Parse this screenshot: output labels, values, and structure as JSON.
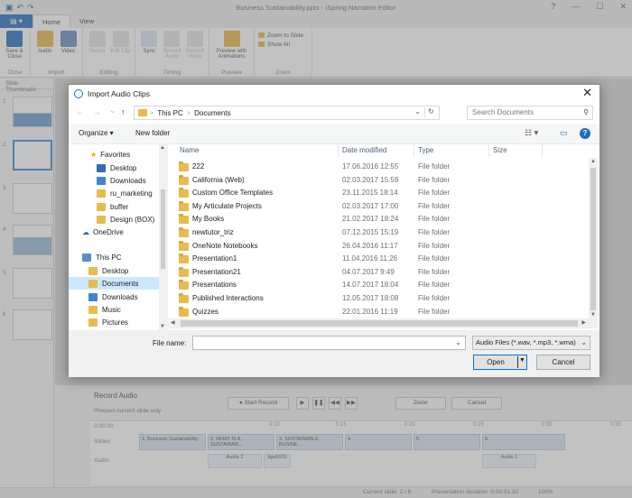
{
  "app": {
    "window_title": "Business Sustainability.pptx - iSpring Narration Editor",
    "file_button": "▤ ▾",
    "tabs": [
      "Home",
      "View"
    ],
    "ribbon_groups": [
      {
        "name": "Close",
        "buttons": [
          "Save & Close"
        ]
      },
      {
        "name": "Import",
        "buttons": [
          "Audio",
          "Video"
        ]
      },
      {
        "name": "Editing",
        "buttons": [
          "Delete",
          "Edit Clip"
        ]
      },
      {
        "name": "Timing",
        "buttons": [
          "Sync",
          "Record Audio",
          "Record Video"
        ]
      },
      {
        "name": "Preview",
        "buttons": [
          "Preview with Animations"
        ]
      },
      {
        "name": "Zoom",
        "links": [
          "Zoom to Slide",
          "Show All"
        ]
      }
    ],
    "thumbs_header": "Slide Thumbnails",
    "thumb_numbers": [
      "1",
      "2",
      "3",
      "4",
      "5",
      "6"
    ],
    "record_title": "Record Audio",
    "process_label": "Process current slide only",
    "record_buttons": {
      "start": "● Start Record",
      "done": "Done",
      "cancel": "Cancel"
    },
    "timeline": {
      "row_labels": [
        "0:00.00",
        "Slides",
        "Audio"
      ],
      "ticks": [
        "0:10",
        "0:15",
        "0:20",
        "0:25",
        "0:30",
        "0:35"
      ],
      "slide_clips": [
        "1. Business Sustainability",
        "2. WHAT IS A SUSTAINAB...",
        "3. SUSTAINABLE BUSINE...",
        "4.",
        "5.",
        "6."
      ],
      "audio_clips": [
        "Audio 2",
        "bgs0020",
        "Audio 1"
      ]
    },
    "status": {
      "current_slide": "Current slide: 2 / 6",
      "duration": "Presentation duration: 0:00:51.32",
      "zoom": "100%"
    }
  },
  "dialog": {
    "title": "Import Audio Clips",
    "close_glyph": "✕",
    "nav": {
      "back": "←",
      "forward": "→",
      "recent": "⌄",
      "up": "↑"
    },
    "address": [
      "This PC",
      "Documents"
    ],
    "search_placeholder": "Search Documents",
    "toolbar": {
      "organize": "Organize ▾",
      "new_folder": "New folder",
      "view_glyph": "☷ ▾",
      "pane_glyph": "▭",
      "help_glyph": "?"
    },
    "nav_pane": {
      "favorites_label": "Favorites",
      "favorites": [
        "Desktop",
        "Downloads",
        "ru_marketing",
        "buffer",
        "Design (BOX)"
      ],
      "onedrive": "OneDrive",
      "thispc_label": "This PC",
      "thispc": [
        "Desktop",
        "Documents",
        "Downloads",
        "Music",
        "Pictures"
      ]
    },
    "columns": {
      "name": "Name",
      "date": "Date modified",
      "type": "Type",
      "size": "Size"
    },
    "files": [
      {
        "name": "222",
        "date": "17.06.2016 12:55",
        "type": "File folder"
      },
      {
        "name": "California (Web)",
        "date": "02.03.2017 15:59",
        "type": "File folder"
      },
      {
        "name": "Custom Office Templates",
        "date": "23.11.2015 18:14",
        "type": "File folder"
      },
      {
        "name": "My Articulate Projects",
        "date": "02.03.2017 17:00",
        "type": "File folder"
      },
      {
        "name": "My Books",
        "date": "21.02.2017 18:24",
        "type": "File folder"
      },
      {
        "name": "newtutor_triz",
        "date": "07.12.2015 15:19",
        "type": "File folder"
      },
      {
        "name": "OneNote Notebooks",
        "date": "26.04.2016 11:17",
        "type": "File folder"
      },
      {
        "name": "Presentation1",
        "date": "11.04.2016 11:26",
        "type": "File folder"
      },
      {
        "name": "Presentation21",
        "date": "04.07.2017 9:49",
        "type": "File folder"
      },
      {
        "name": "Presentations",
        "date": "14.07.2017 18:04",
        "type": "File folder"
      },
      {
        "name": "Published Interactions",
        "date": "12.05.2017 18:08",
        "type": "File folder"
      },
      {
        "name": "Quizzes",
        "date": "22.01.2016 11:19",
        "type": "File folder"
      }
    ],
    "filename_label": "File name:",
    "filename_value": "",
    "filetype": "Audio Files (*.wav, *.mp3, *.wma)",
    "open_label": "Open",
    "cancel_label": "Cancel"
  },
  "colors": {
    "accent": "#1e6fb8",
    "folder": "#e8bb4f",
    "selection": "#cce8ff"
  }
}
